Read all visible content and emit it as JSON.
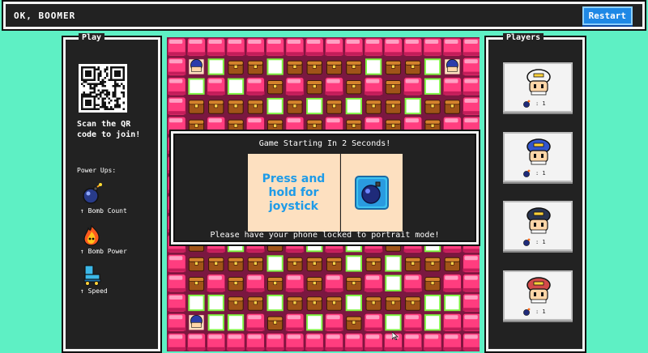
{
  "header": {
    "title": "OK, BOOMER",
    "restart_label": "Restart"
  },
  "play_panel": {
    "title": "Play",
    "scan_text": "Scan the QR code to join!",
    "powerups_label": "Power Ups:",
    "powerups": [
      {
        "icon": "bomb-count-icon",
        "label": "↑ Bomb Count"
      },
      {
        "icon": "bomb-power-icon",
        "label": "↑ Bomb Power"
      },
      {
        "icon": "speed-icon",
        "label": "↑ Speed"
      }
    ]
  },
  "modal": {
    "title": "Game Starting In 2 Seconds!",
    "press_text": "Press and hold for joystick",
    "bottom_text": "Please have your phone locked to portrait mode!"
  },
  "players_panel": {
    "title": "Players",
    "players": [
      {
        "hat_color": "#f4f4f4",
        "bombs": ": 1"
      },
      {
        "hat_color": "#3355cc",
        "bombs": ": 1"
      },
      {
        "hat_color": "#2a3550",
        "bombs": ": 1"
      },
      {
        "hat_color": "#d24a4a",
        "bombs": ": 1"
      }
    ]
  },
  "colors": {
    "background": "#5ef0c4",
    "panel": "#222222",
    "wall": "#ff3d7f",
    "floor": "#7a1840",
    "crate": "#a05418",
    "accent": "#1e88e5"
  },
  "board": {
    "layout": [
      "WWWWWWWWWWWWWWWW",
      "WPGCCGCCCCGCCGPW",
      "WGWGWCWCWCWCWGWW",
      "WCCCCGCGCGCCGCCW",
      "WCWCWCWCWCWCWCWW",
      "WCCCCCCCCCCCCCCW",
      "WCWCWCWCWCWCWCWW",
      "WCCCCCCCCCCCCCCW",
      "WCWCWCWCWCWCWCWW",
      "WCCCCCCCCCCCCCCW",
      "WCWGWCWGWGWCWGWW",
      "WCCCCGCCCGCGCCCW",
      "WCWCWCWCWCWGWCWW",
      "WGGCCGCCCGCCCGGW",
      "WPGGWCWGWCWGWGWW",
      "WWWWWWWWWWWWWWWW"
    ]
  }
}
